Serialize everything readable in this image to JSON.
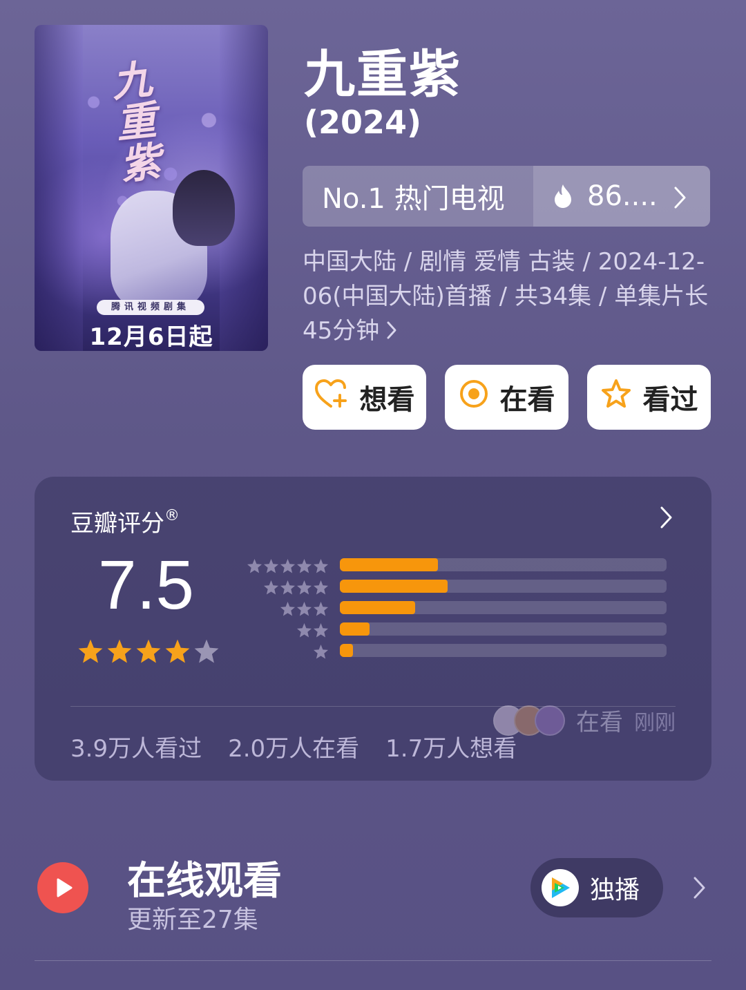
{
  "poster": {
    "calligraphy": "九重紫",
    "badge": "腾讯视频剧集",
    "date": "12月6日起"
  },
  "title": "九重紫",
  "year": "(2024)",
  "rank": {
    "label": "No.1 热门电视",
    "heat": "86...."
  },
  "meta": {
    "line": "中国大陆 / 剧情 爱情 古装 / 2024-12-06(中国大陆)首播 / 共34集 / 单集片长45分钟"
  },
  "actions": [
    {
      "label": "想看",
      "icon": "heart-plus-icon"
    },
    {
      "label": "在看",
      "icon": "watching-circle-icon"
    },
    {
      "label": "看过",
      "icon": "star-outline-icon"
    }
  ],
  "rating": {
    "title": "豆瓣评分",
    "registered": "®",
    "score": "7.5",
    "stars": 4,
    "distribution": [
      {
        "stars": 5,
        "fraction": 0.3
      },
      {
        "stars": 4,
        "fraction": 0.33
      },
      {
        "stars": 3,
        "fraction": 0.23
      },
      {
        "stars": 2,
        "fraction": 0.09
      },
      {
        "stars": 1,
        "fraction": 0.04
      }
    ],
    "counts": [
      "3.9万人看过",
      "2.0万人在看",
      "1.7万人想看"
    ],
    "watching_label": "在看",
    "watching_time": "刚刚"
  },
  "online": {
    "title": "在线观看",
    "subtitle": "更新至27集",
    "exclusive_label": "独播"
  },
  "colors": {
    "accent_orange": "#f7960c",
    "star_gold": "#f7a21b",
    "play_red": "#ef5350"
  }
}
